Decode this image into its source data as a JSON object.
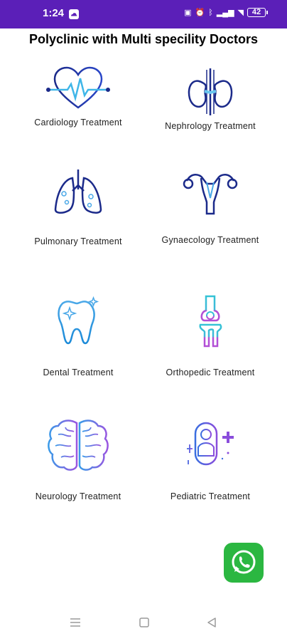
{
  "status_bar": {
    "time": "1:24",
    "battery": "42",
    "bg_color": "#5b1fb8"
  },
  "page": {
    "title": "Polyclinic with Multi specility Doctors"
  },
  "treatments": [
    {
      "label": "Cardiology Treatment",
      "icon": "heart-icon"
    },
    {
      "label": "Nephrology Treatment",
      "icon": "kidney-icon"
    },
    {
      "label": "Pulmonary Treatment",
      "icon": "lungs-icon"
    },
    {
      "label": "Gynaecology Treatment",
      "icon": "uterus-icon"
    },
    {
      "label": "Dental Treatment",
      "icon": "tooth-icon"
    },
    {
      "label": "Orthopedic Treatment",
      "icon": "knee-bone-icon"
    },
    {
      "label": "Neurology Treatment",
      "icon": "brain-icon"
    },
    {
      "label": "Pediatric Treatment",
      "icon": "baby-icon"
    }
  ],
  "fab": {
    "icon": "whatsapp-icon",
    "color": "#2bb741"
  },
  "navbar": {
    "menu_icon": "menu-icon",
    "home_icon": "home-square-icon",
    "back_icon": "back-triangle-icon"
  }
}
